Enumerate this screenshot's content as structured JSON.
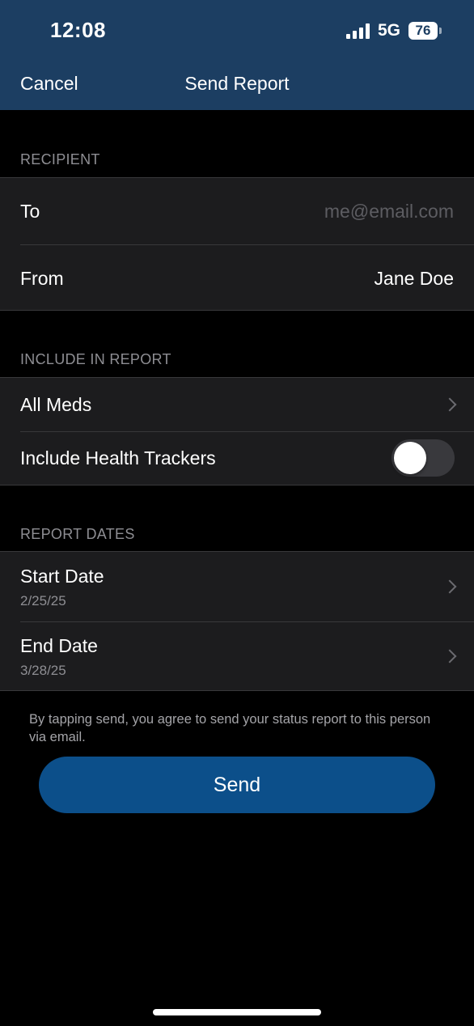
{
  "status_bar": {
    "time": "12:08",
    "network": "5G",
    "battery": "76"
  },
  "nav": {
    "cancel_label": "Cancel",
    "title": "Send Report"
  },
  "recipient": {
    "header": "RECIPIENT",
    "to_label": "To",
    "to_placeholder": "me@email.com",
    "from_label": "From",
    "from_value": "Jane Doe"
  },
  "include": {
    "header": "INCLUDE IN REPORT",
    "meds_label": "All Meds",
    "trackers_label": "Include Health Trackers",
    "trackers_on": false
  },
  "dates": {
    "header": "REPORT DATES",
    "start_label": "Start Date",
    "start_value": "2/25/25",
    "end_label": "End Date",
    "end_value": "3/28/25"
  },
  "disclaimer": "By tapping send, you agree to send your status report to this person via email.",
  "send_label": "Send",
  "colors": {
    "header_bg": "#1c3e62",
    "button": "#0c4f8a",
    "cell_bg": "#1c1c1e",
    "secondary_text": "#8e8e93"
  }
}
